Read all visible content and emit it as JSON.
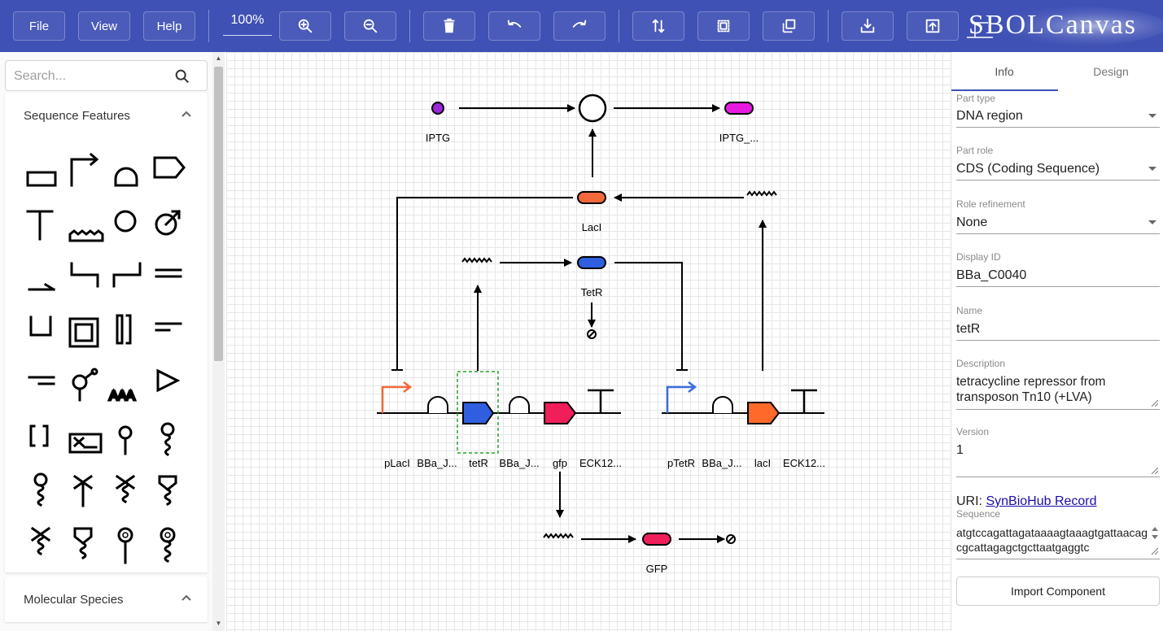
{
  "toolbar": {
    "file_label": "File",
    "view_label": "View",
    "help_label": "Help",
    "zoom_level": "100%",
    "icons": [
      "zoom-in-icon",
      "zoom-out-icon",
      "delete-icon",
      "undo-icon",
      "redo-icon",
      "flip-icon",
      "select-box-icon",
      "duplicate-icon",
      "download-icon",
      "upload-icon"
    ],
    "logo_text": "SBOLCanvas"
  },
  "left_panel": {
    "search_placeholder": "Search...",
    "sequence_features_title": "Sequence Features",
    "molecular_species_title": "Molecular Species"
  },
  "canvas": {
    "labels": {
      "iptg": "IPTG",
      "iptg_complex": "IPTG_...",
      "laci_protein": "LacI",
      "tetr_protein": "TetR",
      "gfp_protein": "GFP",
      "plac": "pLacI",
      "bba_j1": "BBa_J...",
      "tetr_cds": "tetR",
      "bba_j2": "BBa_J...",
      "gfp_cds": "gfp",
      "eck1": "ECK12...",
      "ptet": "pTetR",
      "bba_j3": "BBa_J...",
      "laci_cds": "lacI",
      "eck2": "ECK12..."
    },
    "colors": {
      "promoter_orange": "#f4683b",
      "promoter_blue": "#3b6de0",
      "cds_blue": "#2f5fe0",
      "cds_pink": "#f01e5a",
      "cds_orange": "#ff6a2a",
      "iptg_purple": "#9c27d8",
      "complex_magenta": "#e81ae0",
      "selection_green": "#2aa02a"
    }
  },
  "right_panel": {
    "tabs": [
      "Info",
      "Design"
    ],
    "part_type_label": "Part type",
    "part_type_value": "DNA region",
    "part_role_label": "Part role",
    "part_role_value": "CDS (Coding Sequence)",
    "role_refinement_label": "Role refinement",
    "role_refinement_value": "None",
    "display_id_label": "Display ID",
    "display_id_value": "BBa_C0040",
    "name_label": "Name",
    "name_value": "tetR",
    "description_label": "Description",
    "description_value": "tetracycline repressor from transposon Tn10 (+LVA)",
    "version_label": "Version",
    "version_value": "1",
    "uri_prefix": "URI:",
    "uri_link_text": "SynBioHub Record",
    "sequence_label": "Sequence",
    "sequence_value": "atgtccagattagataaaagtaaagtgattaacagcgcattagagctgcttaatgaggtc",
    "import_button": "Import Component"
  }
}
